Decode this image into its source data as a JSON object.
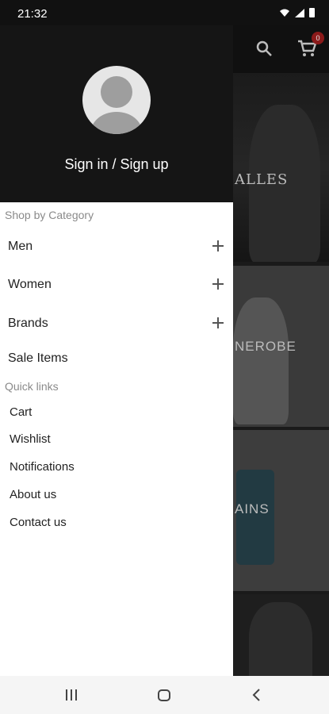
{
  "status_bar": {
    "time": "21:32",
    "icons": [
      "wifi-icon",
      "volte-icon",
      "signal-icon",
      "battery-icon"
    ]
  },
  "background": {
    "cart_count": "0",
    "tiles": [
      {
        "label": "ALLES"
      },
      {
        "label": "NEROBE"
      },
      {
        "label": "AINS"
      },
      {
        "label": ""
      }
    ]
  },
  "drawer": {
    "sign_in_label": "Sign in / Sign up",
    "category_heading": "Shop by Category",
    "categories": [
      {
        "label": "Men"
      },
      {
        "label": "Women"
      },
      {
        "label": "Brands"
      }
    ],
    "sale_label": "Sale Items",
    "quick_links_heading": "Quick links",
    "quick_links": [
      {
        "label": "Cart"
      },
      {
        "label": "Wishlist"
      },
      {
        "label": "Notifications"
      },
      {
        "label": "About us"
      },
      {
        "label": "Contact us"
      }
    ]
  },
  "colors": {
    "drawer_header": "#151515",
    "cart_badge": "#8b1a1a",
    "section_label": "#8a8a8a"
  }
}
